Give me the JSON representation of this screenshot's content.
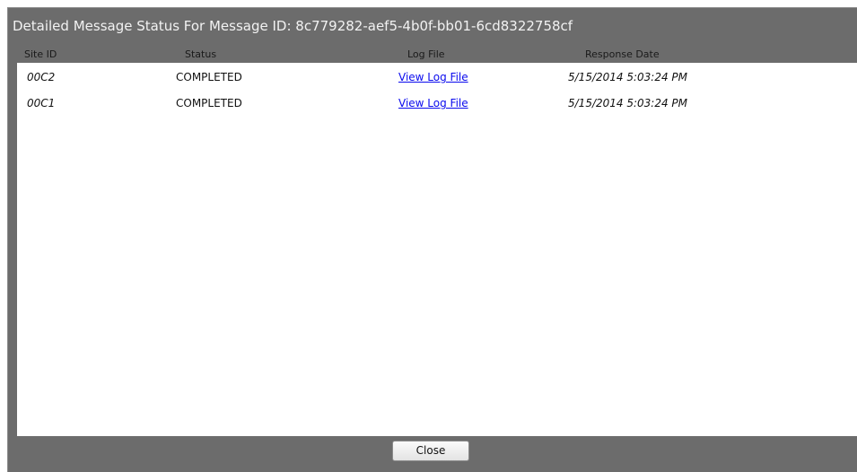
{
  "dialog": {
    "title": "Detailed Message Status For Message ID: 8c779282-aef5-4b0f-bb01-6cd8322758cf",
    "close_label": "Close"
  },
  "table": {
    "headers": {
      "site_id": "Site ID",
      "status": "Status",
      "log_file": "Log File",
      "response_date": "Response Date"
    },
    "rows": [
      {
        "site_id": "00C2",
        "status": "COMPLETED",
        "log_file": "View Log File",
        "response_date": "5/15/2014 5:03:24 PM"
      },
      {
        "site_id": "00C1",
        "status": "COMPLETED",
        "log_file": "View Log File",
        "response_date": "5/15/2014 5:03:24 PM"
      }
    ]
  },
  "colors": {
    "dialog_background": "#6c6c6c",
    "link": "#0a0aee"
  }
}
